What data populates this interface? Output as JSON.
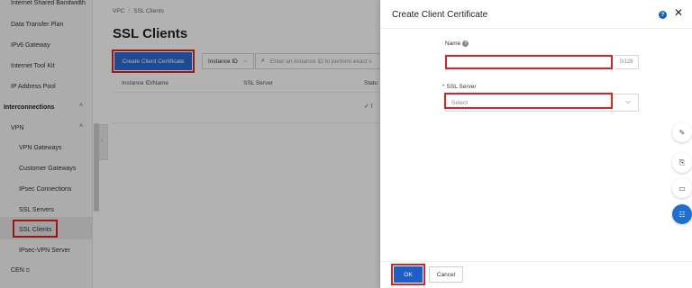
{
  "sidebar": {
    "items_top": [
      {
        "label": "Internet Shared Bandwidth"
      },
      {
        "label": "Data Transfer Plan"
      },
      {
        "label": "IPv6 Gateway"
      },
      {
        "label": "Internet Tool Kit"
      },
      {
        "label": "IP Address Pool"
      }
    ],
    "group_label": "Interconnections",
    "vpn_label": "VPN",
    "vpn_items": [
      {
        "label": "VPN Gateways"
      },
      {
        "label": "Customer Gateways"
      },
      {
        "label": "IPsec Connections"
      },
      {
        "label": "SSL Servers"
      },
      {
        "label": "SSL Clients"
      },
      {
        "label": "IPsec-VPN Server"
      }
    ],
    "cen_label": "CEN"
  },
  "breadcrumb": {
    "root": "VPC",
    "sep": "/",
    "current": "SSL Clients"
  },
  "page": {
    "title": "SSL Clients",
    "create_button": "Create Client Certificate",
    "filter_label": "Instance ID",
    "search_placeholder": "Enter an instance ID to perform exact s",
    "columns": [
      "Instance ID/Name",
      "SSL Server",
      "Statu"
    ],
    "row_status": "✓ I"
  },
  "drawer": {
    "title": "Create Client Certificate",
    "name_label": "Name",
    "name_value": "",
    "name_counter": "0/128",
    "ssl_label": "SSL Server",
    "ssl_placeholder": "Select",
    "ok_label": "OK",
    "cancel_label": "Cancel"
  },
  "icons": {
    "help": "?",
    "close": "✕",
    "chevron_down": "⌵",
    "chevron_up": "˄",
    "search": "⌕",
    "edit": "✎",
    "clipboard": "⎘",
    "chat": "▭",
    "apps": "☷",
    "external": "⧉"
  },
  "colors": {
    "primary": "#1d5fc7",
    "highlight": "#e02020"
  }
}
